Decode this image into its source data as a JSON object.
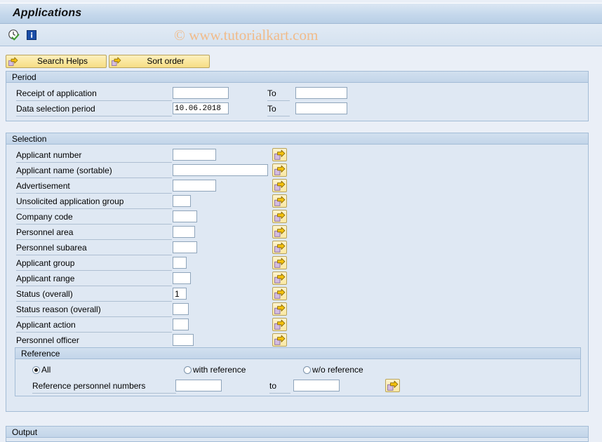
{
  "window": {
    "title": "Applications"
  },
  "watermark": "© www.tutorialkart.com",
  "toolbar": {
    "icons": [
      {
        "name": "execute-clock-icon",
        "title": "Execute"
      },
      {
        "name": "information-icon",
        "title": "Information"
      }
    ]
  },
  "buttons": {
    "search_helps": "Search Helps",
    "sort_order": "Sort order"
  },
  "period": {
    "header": "Period",
    "rows": [
      {
        "label": "Receipt of application",
        "value": "",
        "to_label": "To",
        "to_value": ""
      },
      {
        "label": "Data selection period",
        "value": "10.06.2018",
        "to_label": "To",
        "to_value": ""
      }
    ]
  },
  "selection": {
    "header": "Selection",
    "rows": [
      {
        "label": "Applicant number",
        "value": "",
        "field_width": 62,
        "has_arrow": true
      },
      {
        "label": "Applicant name (sortable)",
        "value": "",
        "field_width": 136,
        "has_arrow": true
      },
      {
        "label": "Advertisement",
        "value": "",
        "field_width": 62,
        "has_arrow": true
      },
      {
        "label": "Unsolicited application group",
        "value": "",
        "field_width": 26,
        "has_arrow": true
      },
      {
        "label": "Company code",
        "value": "",
        "field_width": 35,
        "has_arrow": true
      },
      {
        "label": "Personnel area",
        "value": "",
        "field_width": 32,
        "has_arrow": true
      },
      {
        "label": "Personnel subarea",
        "value": "",
        "field_width": 35,
        "has_arrow": true
      },
      {
        "label": "Applicant group",
        "value": "",
        "field_width": 20,
        "has_arrow": true
      },
      {
        "label": "Applicant range",
        "value": "",
        "field_width": 26,
        "has_arrow": true
      },
      {
        "label": "Status (overall)",
        "value": "1",
        "field_width": 20,
        "has_arrow": true
      },
      {
        "label": "Status reason (overall)",
        "value": "",
        "field_width": 23,
        "has_arrow": true
      },
      {
        "label": "Applicant action",
        "value": "",
        "field_width": 23,
        "has_arrow": true
      },
      {
        "label": "Personnel officer",
        "value": "",
        "field_width": 30,
        "has_arrow": true
      }
    ]
  },
  "reference": {
    "header": "Reference",
    "radios": [
      {
        "label": "All",
        "selected": true
      },
      {
        "label": "with reference",
        "selected": false
      },
      {
        "label": "w/o reference",
        "selected": false
      }
    ],
    "personnel_numbers": {
      "label": "Reference personnel numbers",
      "from_value": "",
      "to_label": "to",
      "to_value": ""
    }
  },
  "output": {
    "header": "Output"
  },
  "colors": {
    "page_background": "#eaeff7",
    "group_background": "#dfe8f3",
    "group_border": "#a3bcd6",
    "titlebar_start": "#dce7f3",
    "titlebar_end": "#b9cfe6",
    "button_yellow": "#fae79f",
    "button_border": "#b9a45c",
    "arrow_yellow": "#f5c20c",
    "arrow_lavender": "#d3bce0",
    "watermark": "#f0bb8a",
    "input_border": "#8fa5bb",
    "input_background": "#ffffff"
  }
}
